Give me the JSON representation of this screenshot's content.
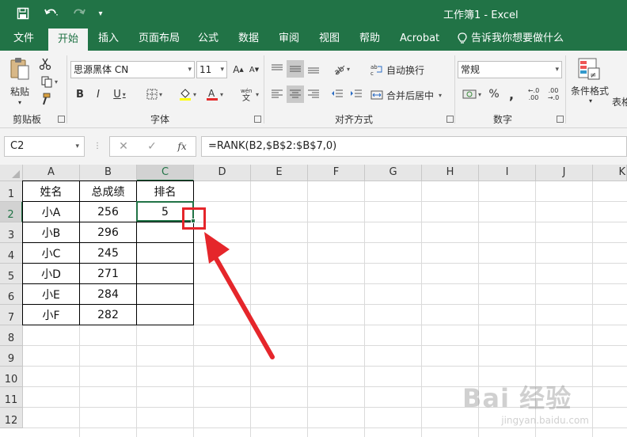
{
  "window": {
    "title": "工作簿1  -  Excel"
  },
  "tabs": [
    {
      "id": "file",
      "label": "文件"
    },
    {
      "id": "home",
      "label": "开始"
    },
    {
      "id": "insert",
      "label": "插入"
    },
    {
      "id": "page-layout",
      "label": "页面布局"
    },
    {
      "id": "formulas",
      "label": "公式"
    },
    {
      "id": "data",
      "label": "数据"
    },
    {
      "id": "review",
      "label": "审阅"
    },
    {
      "id": "view",
      "label": "视图"
    },
    {
      "id": "help",
      "label": "帮助"
    },
    {
      "id": "acrobat",
      "label": "Acrobat"
    }
  ],
  "tell_me": "告诉我你想要做什么",
  "ribbon": {
    "clipboard": {
      "label": "剪贴板",
      "paste": "粘贴"
    },
    "font": {
      "label": "字体",
      "font_name": "思源黑体 CN",
      "font_size": "11"
    },
    "alignment": {
      "label": "对齐方式",
      "wrap_text": "自动换行",
      "merge_center": "合并后居中"
    },
    "number": {
      "label": "数字",
      "format": "常规"
    },
    "styles": {
      "conditional_format": "条件格式",
      "table_partial": "表格"
    }
  },
  "formula_bar": {
    "name_box": "C2",
    "formula": "=RANK(B2,$B$2:$B$7,0)"
  },
  "columns": [
    "A",
    "B",
    "C",
    "D",
    "E",
    "F",
    "G",
    "H",
    "I",
    "J",
    "K"
  ],
  "rows": [
    "1",
    "2",
    "3",
    "4",
    "5",
    "6",
    "7",
    "8",
    "9",
    "10",
    "11",
    "12"
  ],
  "table": {
    "headers": [
      "姓名",
      "总成绩",
      "排名"
    ],
    "rows": [
      [
        "小A",
        "256",
        "5"
      ],
      [
        "小B",
        "296",
        ""
      ],
      [
        "小C",
        "245",
        ""
      ],
      [
        "小D",
        "271",
        ""
      ],
      [
        "小E",
        "284",
        ""
      ],
      [
        "小F",
        "282",
        ""
      ]
    ]
  },
  "watermark": {
    "text": "Bai 经验",
    "url": "jingyan.baidu.com"
  },
  "colors": {
    "excel_green": "#217346",
    "highlight_red": "#e5262b",
    "ribbon_bg": "#f3f3f3"
  }
}
